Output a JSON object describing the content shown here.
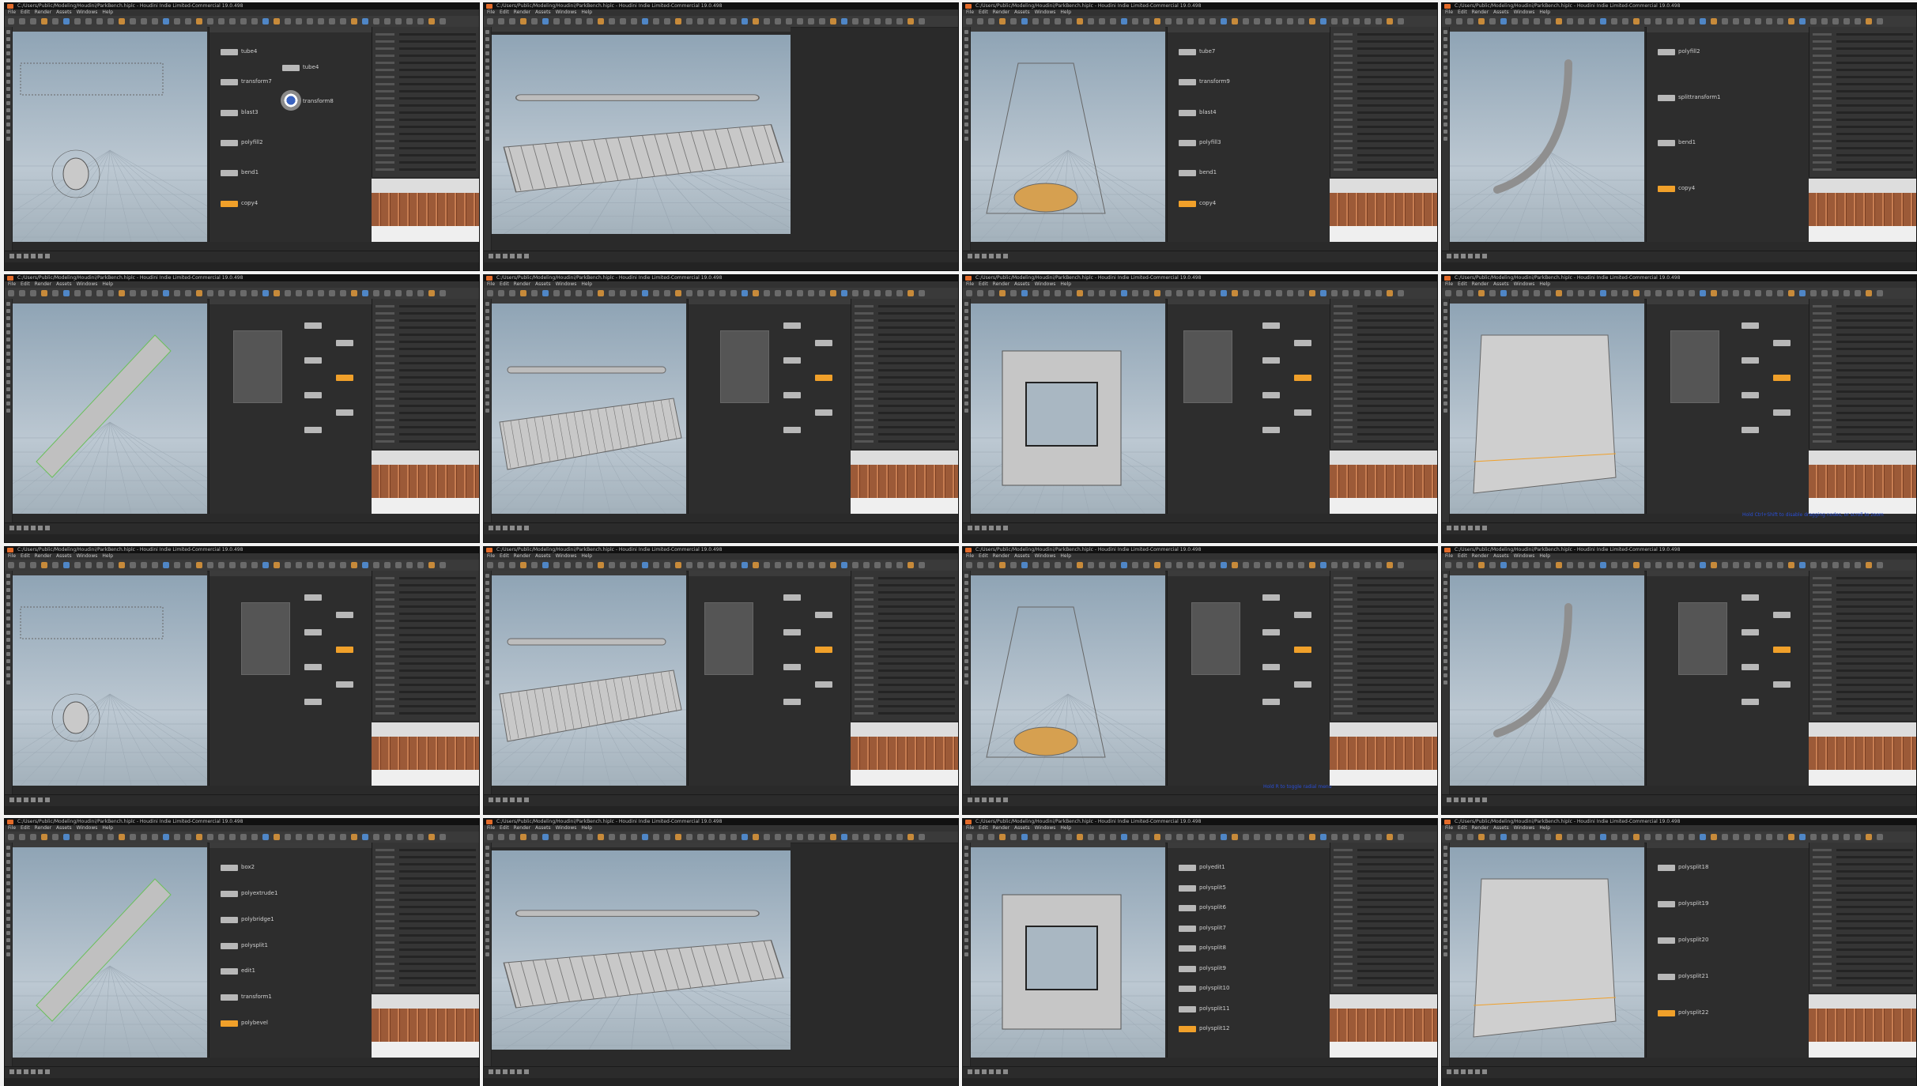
{
  "app": {
    "window_title": "C:/Users/Public/Modeling/Houdini/ParkBench.hiplc - Houdini Indie Limited-Commercial 19.0.498",
    "menu": [
      "File",
      "Edit",
      "Render",
      "Assets",
      "Windows",
      "Help"
    ],
    "accent": "#f0a02a",
    "node_default": "#b8b8b8"
  },
  "panes": [
    {
      "id": "p1",
      "nodes": [
        {
          "label": "tube4"
        },
        {
          "label": "transform7"
        },
        {
          "label": "blast3"
        },
        {
          "label": "polyfill2"
        },
        {
          "label": "bend1"
        },
        {
          "label": "copy4"
        }
      ],
      "side_node": {
        "label": "tube4"
      },
      "side_node2": {
        "label": "transform8"
      }
    },
    {
      "id": "p2",
      "nodes": []
    },
    {
      "id": "p3",
      "nodes": [
        {
          "label": "tube7"
        },
        {
          "label": "transform9"
        },
        {
          "label": "blast4"
        },
        {
          "label": "polyfill3"
        },
        {
          "label": "bend1"
        },
        {
          "label": "copy4"
        }
      ]
    },
    {
      "id": "p4",
      "nodes": [
        {
          "label": "polyfill2"
        },
        {
          "label": "splittransform1"
        },
        {
          "label": "bend1"
        },
        {
          "label": "copy4"
        }
      ]
    },
    {
      "id": "p13",
      "nodes": [
        {
          "label": "box2"
        },
        {
          "label": "polyextrude1"
        },
        {
          "label": "polybridge1"
        },
        {
          "label": "polysplit1"
        },
        {
          "label": "edit1"
        },
        {
          "label": "transform1"
        },
        {
          "label": "polybevel"
        }
      ]
    },
    {
      "id": "p15",
      "nodes": [
        {
          "label": "polyedit1"
        },
        {
          "label": "polysplit5"
        },
        {
          "label": "polysplit6"
        },
        {
          "label": "polysplit7"
        },
        {
          "label": "polysplit8"
        },
        {
          "label": "polysplit9"
        },
        {
          "label": "polysplit10"
        },
        {
          "label": "polysplit11"
        },
        {
          "label": "polysplit12"
        }
      ]
    },
    {
      "id": "p16",
      "nodes": [
        {
          "label": "polysplit18"
        },
        {
          "label": "polysplit19"
        },
        {
          "label": "polysplit20"
        },
        {
          "label": "polysplit21"
        },
        {
          "label": "polysplit22"
        }
      ]
    }
  ],
  "captions": {
    "p8": "Hold Ctrl+Shift to disable dragging nodes, or scroll to zoom",
    "p11": "Hold R to toggle radial menu"
  }
}
